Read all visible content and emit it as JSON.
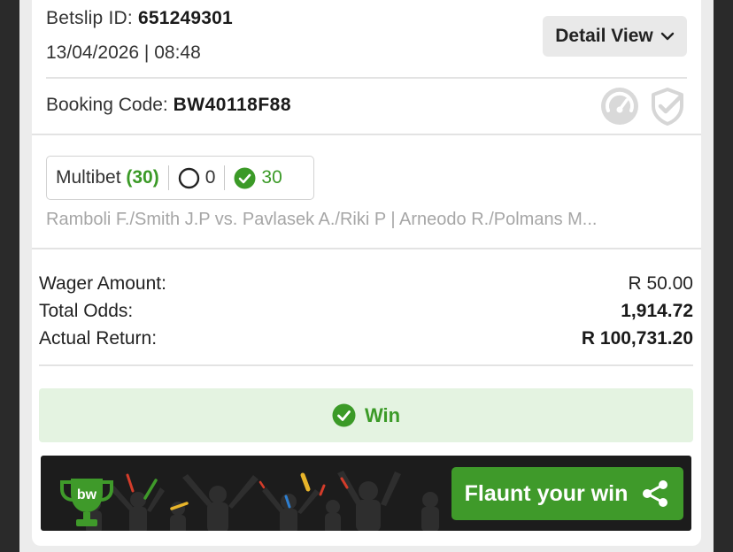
{
  "betslip": {
    "id_label": "Betslip ID:",
    "id_value": "651249301",
    "datetime": "13/04/2026 | 08:48",
    "detail_view_label": "Detail View"
  },
  "booking": {
    "label": "Booking Code:",
    "code": "BW40118F88"
  },
  "multibet": {
    "label": "Multibet",
    "count": "(30)",
    "open_count": "0",
    "won_count": "30",
    "matches": "Ramboli F./Smith J.P vs. Pavlasek A./Riki P | Arneodo R./Polmans M..."
  },
  "summary": {
    "rows": [
      {
        "label": "Wager Amount:",
        "value": "R 50.00"
      },
      {
        "label": "Total Odds:",
        "value": "1,914.72"
      },
      {
        "label": "Actual Return:",
        "value": "R 100,731.20"
      }
    ]
  },
  "result": {
    "status": "Win"
  },
  "promo": {
    "logo_text": "bw",
    "flaunt_label": "Flaunt your win"
  },
  "colors": {
    "accent_green": "#3b9a27",
    "win_bg": "#e4f3e1",
    "button_green": "#3f9a2a",
    "dark_bar": "#1c1c1c"
  },
  "icons": {
    "detail_view": "chevron-down-icon",
    "gauge": "gauge-icon",
    "shield": "shield-check-icon",
    "open": "open-circle-icon",
    "won": "check-circle-icon",
    "win": "check-circle-icon",
    "share": "share-icon",
    "trophy": "trophy-icon"
  }
}
